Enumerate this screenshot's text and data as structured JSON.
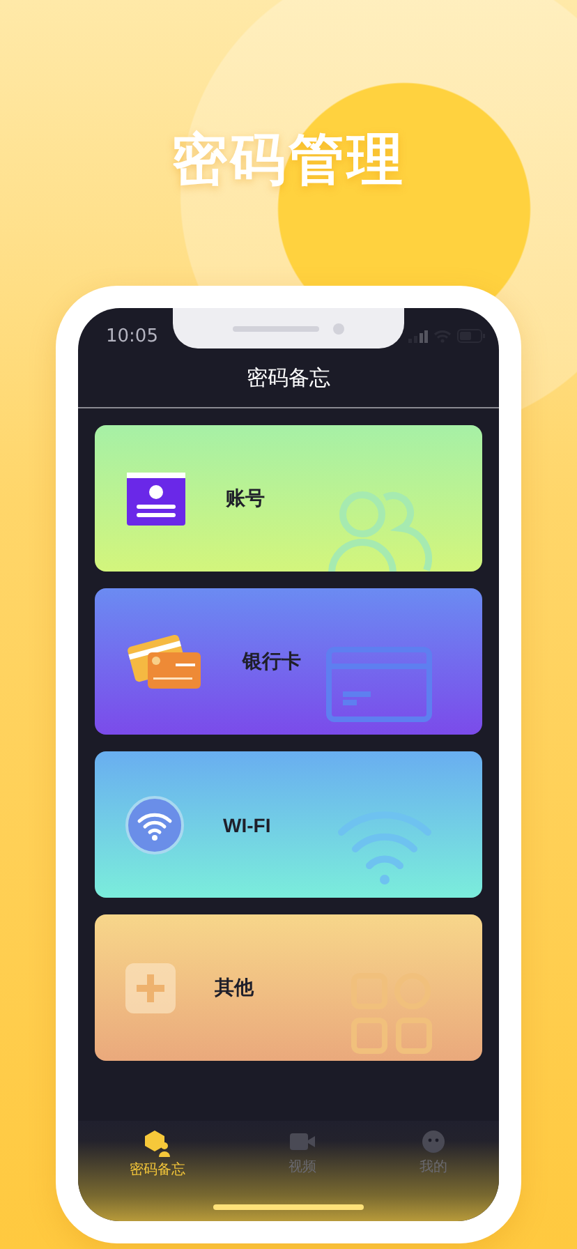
{
  "headline": "密码管理",
  "status_bar": {
    "time": "10:05"
  },
  "nav": {
    "title": "密码备忘"
  },
  "cards": [
    {
      "kind": "account",
      "label": "账号"
    },
    {
      "kind": "bank",
      "label": "银行卡"
    },
    {
      "kind": "wifi",
      "label": "WI-FI"
    },
    {
      "kind": "other",
      "label": "其他"
    }
  ],
  "tab_bar": [
    {
      "kind": "memo",
      "label": "密码备忘",
      "selected": true
    },
    {
      "kind": "video",
      "label": "视频",
      "selected": false
    },
    {
      "kind": "me",
      "label": "我的",
      "selected": false
    }
  ]
}
